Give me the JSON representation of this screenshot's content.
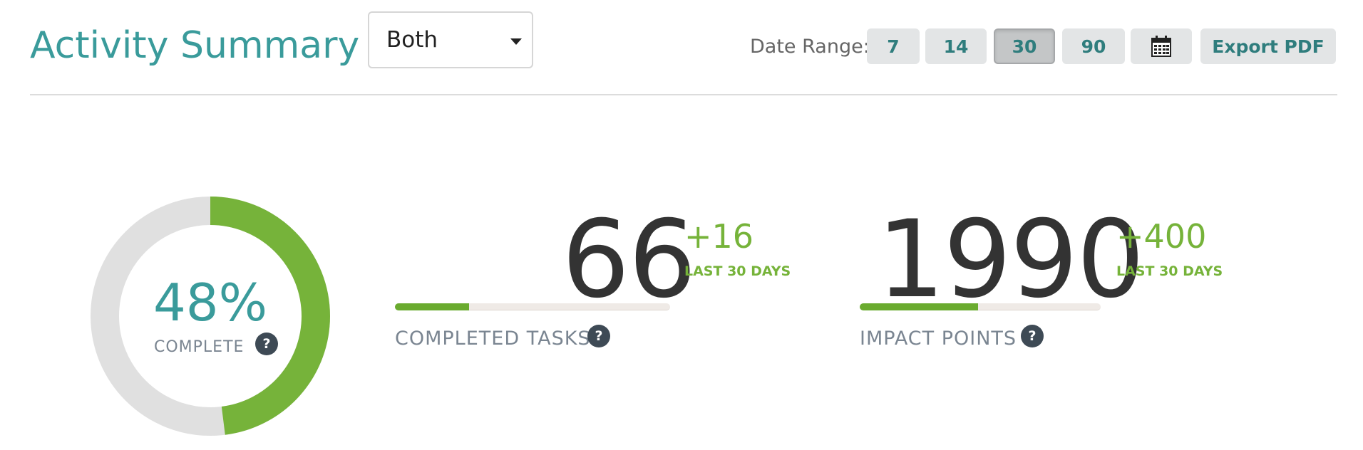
{
  "header": {
    "title": "Activity Summary",
    "filter_select": {
      "value": "Both",
      "icon": "caret-down-icon"
    },
    "date_range": {
      "label": "Date Range:",
      "options": [
        "7",
        "14",
        "30",
        "90"
      ],
      "selected": "30",
      "calendar_icon": "calendar-icon",
      "export_label": "Export PDF"
    }
  },
  "colors": {
    "accent_teal": "#3a9b9b",
    "progress_green": "#76b33a",
    "track_grey": "#e0e0e0",
    "help_badge": "#3e4a55"
  },
  "completion": {
    "percent_value": 48,
    "percent_text": "48%",
    "label": "COMPLETE",
    "help_icon": "?"
  },
  "stats": {
    "tasks": {
      "value": "66",
      "delta": "+16",
      "period": "LAST 30 DAYS",
      "label": "COMPLETED TASKS",
      "progress_fraction": 0.27,
      "help_icon": "?"
    },
    "points": {
      "value": "1990",
      "delta": "+400",
      "period": "LAST 30 DAYS",
      "label": "IMPACT POINTS",
      "progress_fraction": 0.49,
      "help_icon": "?"
    }
  }
}
